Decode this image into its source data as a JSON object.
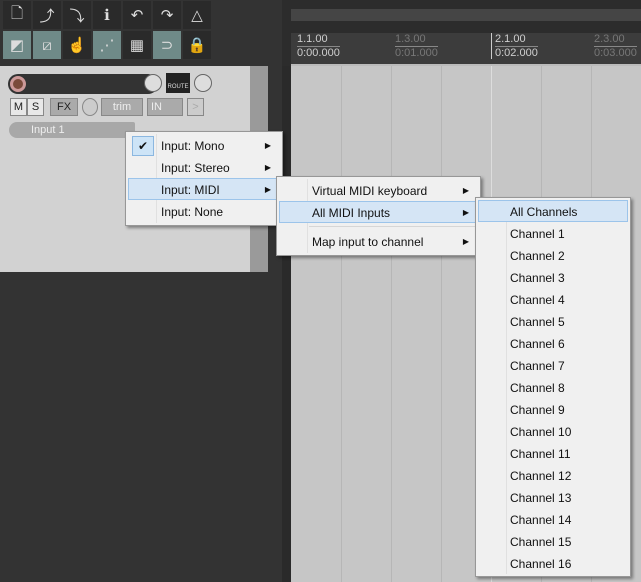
{
  "toolbar": {
    "row1": [
      {
        "icon": "new-project-icon",
        "glyph": "🗋"
      },
      {
        "icon": "open-project-icon",
        "glyph": "⤴"
      },
      {
        "icon": "save-project-icon",
        "glyph": "⤵"
      },
      {
        "icon": "project-info-icon",
        "glyph": "ℹ"
      },
      {
        "icon": "undo-icon",
        "glyph": "↶"
      },
      {
        "icon": "redo-icon",
        "glyph": "↷"
      },
      {
        "icon": "metronome-icon",
        "glyph": "△"
      }
    ],
    "row2": [
      {
        "icon": "auto-crossfade-icon",
        "glyph": "◩"
      },
      {
        "icon": "ripple-edit-icon",
        "glyph": "⧄"
      },
      {
        "icon": "grouping-icon",
        "glyph": "☝"
      },
      {
        "icon": "envelope-points-icon",
        "glyph": "⋰"
      },
      {
        "icon": "grid-icon",
        "glyph": "▦"
      },
      {
        "icon": "snap-icon",
        "glyph": "⊃"
      },
      {
        "icon": "lock-icon",
        "glyph": "🔒"
      }
    ]
  },
  "ruler": {
    "marks": [
      {
        "bar": "1.1.00",
        "time": "0:00.000"
      },
      {
        "bar": "1.3.00",
        "time": "0:01.000"
      },
      {
        "bar": "2.1.00",
        "time": "0:02.000"
      },
      {
        "bar": "2.3.00",
        "time": "0:03.000"
      }
    ]
  },
  "track": {
    "route_label": "ROUTE",
    "mute": "M",
    "solo": "S",
    "fx": "FX",
    "trim": "trim",
    "in": "IN",
    "input_label": "Input 1",
    "fx_small": "FX"
  },
  "menu1": {
    "items": [
      {
        "label": "Input: Mono",
        "checked": true,
        "submenu": true
      },
      {
        "label": "Input: Stereo",
        "submenu": true
      },
      {
        "label": "Input: MIDI",
        "submenu": true,
        "highlighted": true
      },
      {
        "label": "Input: None"
      }
    ],
    "check": "✔"
  },
  "menu2": {
    "items": [
      {
        "label": "Virtual MIDI keyboard",
        "submenu": true
      },
      {
        "label": "All MIDI Inputs",
        "submenu": true,
        "highlighted": true
      },
      {
        "label": "Map input to channel",
        "submenu": true
      }
    ]
  },
  "menu3": {
    "items": [
      "All Channels",
      "Channel 1",
      "Channel 2",
      "Channel 3",
      "Channel 4",
      "Channel 5",
      "Channel 6",
      "Channel 7",
      "Channel 8",
      "Channel 9",
      "Channel 10",
      "Channel 11",
      "Channel 12",
      "Channel 13",
      "Channel 14",
      "Channel 15",
      "Channel 16"
    ]
  },
  "arrow": "▶"
}
